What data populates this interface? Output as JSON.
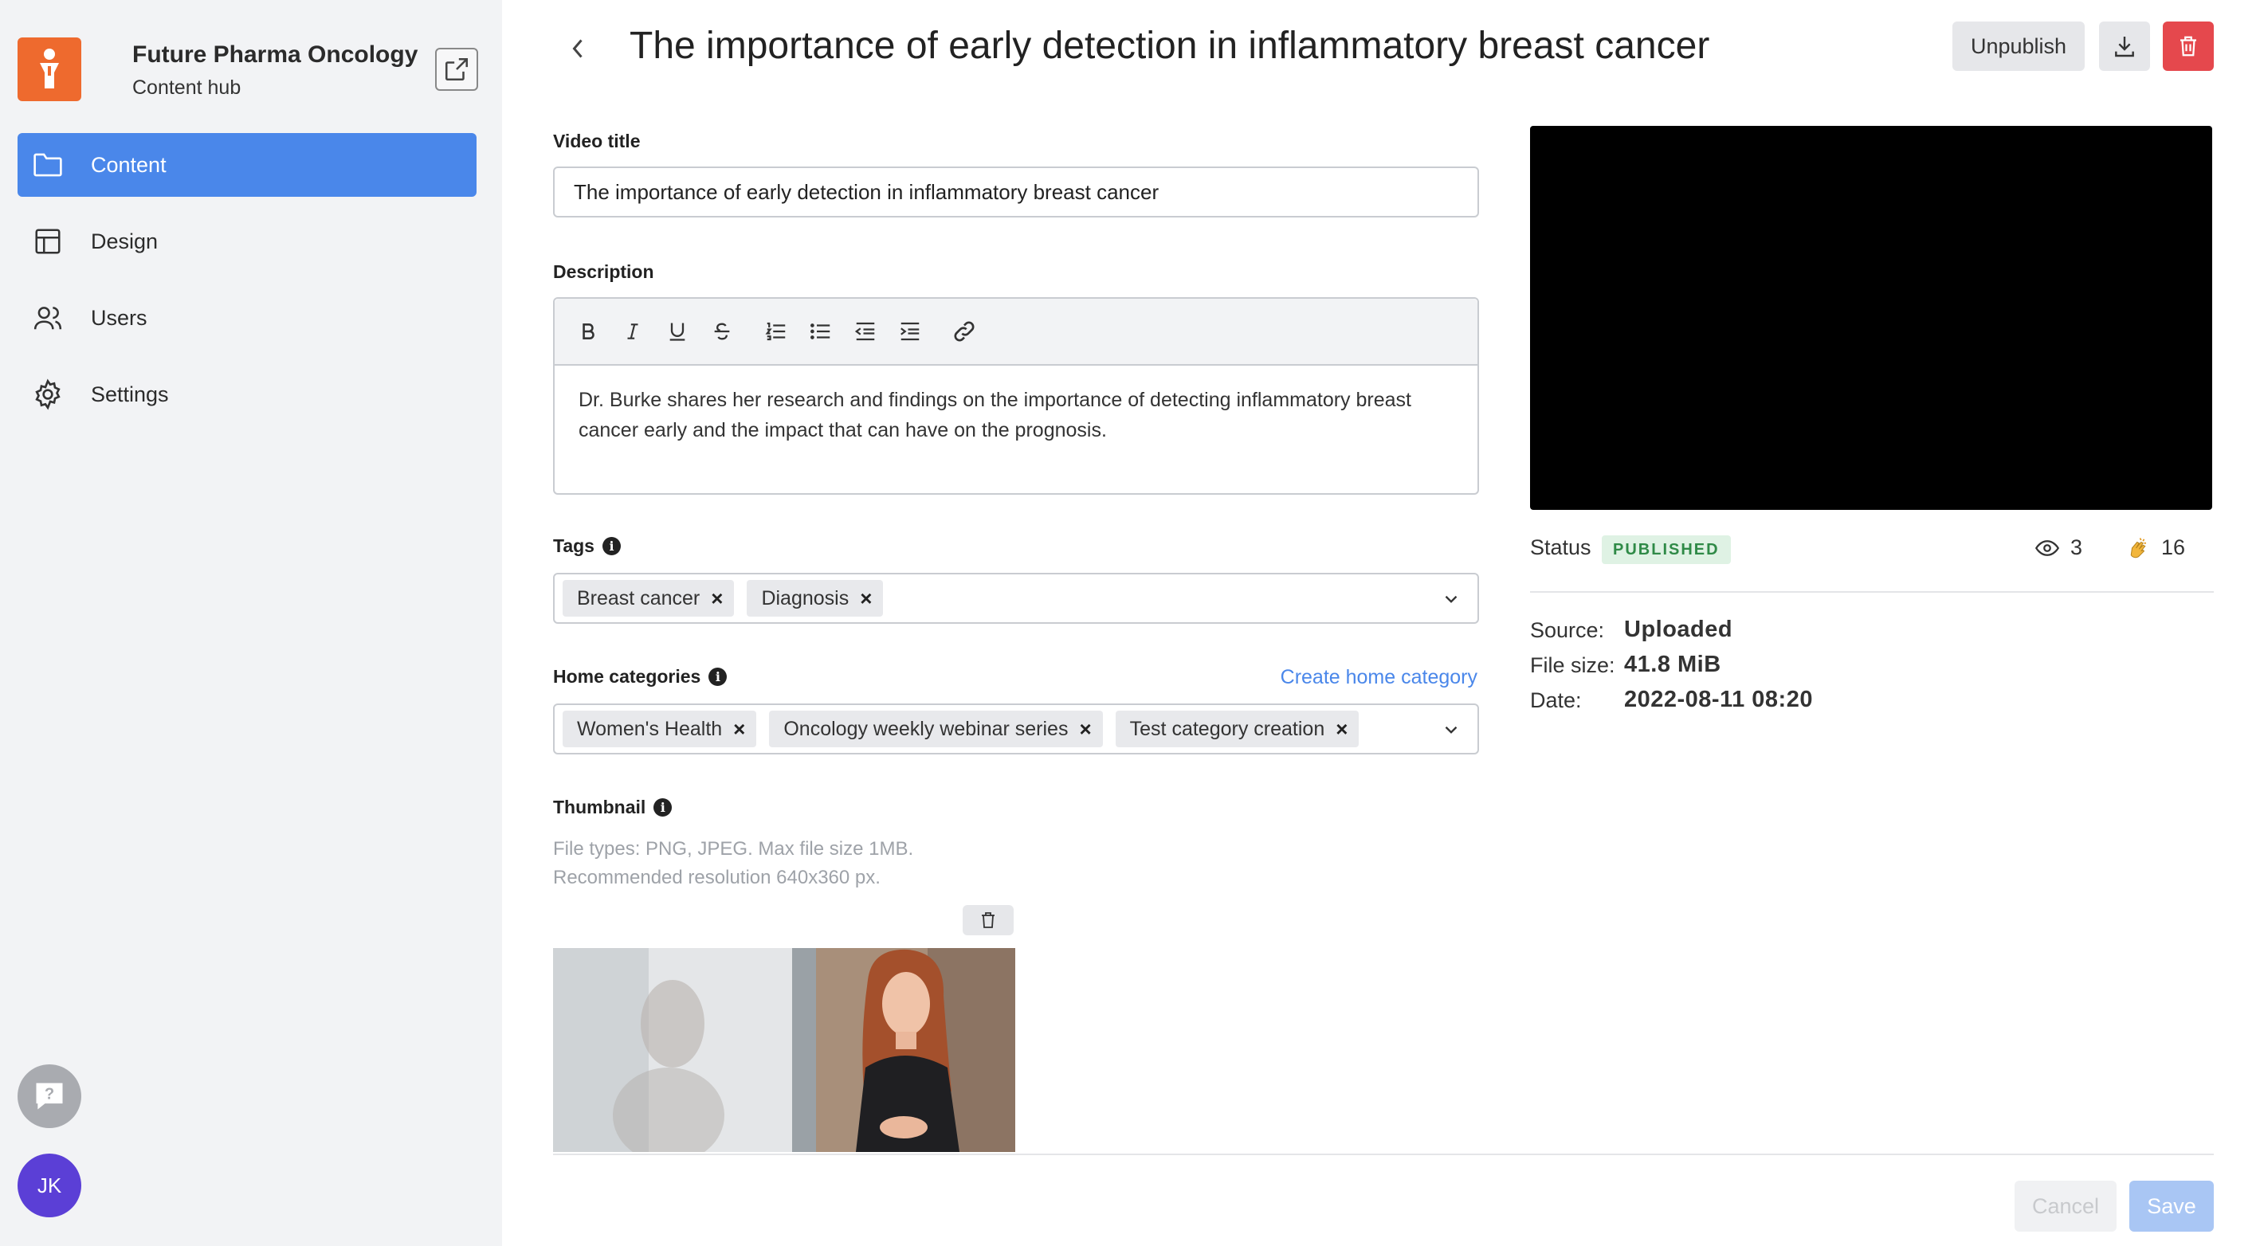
{
  "sidebar": {
    "org_name": "Future Pharma Oncology",
    "org_sub": "Content hub",
    "logo_icon": "person-icon",
    "items": [
      {
        "label": "Content",
        "icon": "folder-icon",
        "active": true
      },
      {
        "label": "Design",
        "icon": "layout-icon",
        "active": false
      },
      {
        "label": "Users",
        "icon": "users-icon",
        "active": false
      },
      {
        "label": "Settings",
        "icon": "gear-icon",
        "active": false
      }
    ],
    "avatar_initials": "JK"
  },
  "header": {
    "title": "The importance of early detection in inflammatory breast cancer",
    "unpublish_label": "Unpublish"
  },
  "form": {
    "video_title_label": "Video title",
    "video_title_value": "The importance of early detection in inflammatory breast cancer",
    "description_label": "Description",
    "description_value": "Dr. Burke shares her research and findings on the importance of detecting inflammatory breast cancer early and the impact that can have on the prognosis.",
    "tags_label": "Tags",
    "tags": [
      "Breast cancer",
      "Diagnosis"
    ],
    "home_categories_label": "Home categories",
    "create_home_category_link": "Create home category",
    "home_categories": [
      "Women's Health",
      "Oncology weekly webinar series",
      "Test category creation"
    ],
    "thumbnail_label": "Thumbnail",
    "thumbnail_hint_1": "File types: PNG, JPEG. Max file size 1MB.",
    "thumbnail_hint_2": "Recommended resolution 640x360 px."
  },
  "details": {
    "status_label": "Status",
    "status_value": "PUBLISHED",
    "views": "3",
    "claps": "16",
    "source_label": "Source:",
    "source_value": "Uploaded",
    "filesize_label": "File size:",
    "filesize_value": "41.8 MiB",
    "date_label": "Date:",
    "date_value": "2022-08-11 08:20"
  },
  "footer": {
    "cancel_label": "Cancel",
    "save_label": "Save"
  },
  "colors": {
    "accent": "#4a87ea",
    "brand": "#ee6a2e",
    "danger": "#e5484d",
    "published": "#2f8a47"
  }
}
